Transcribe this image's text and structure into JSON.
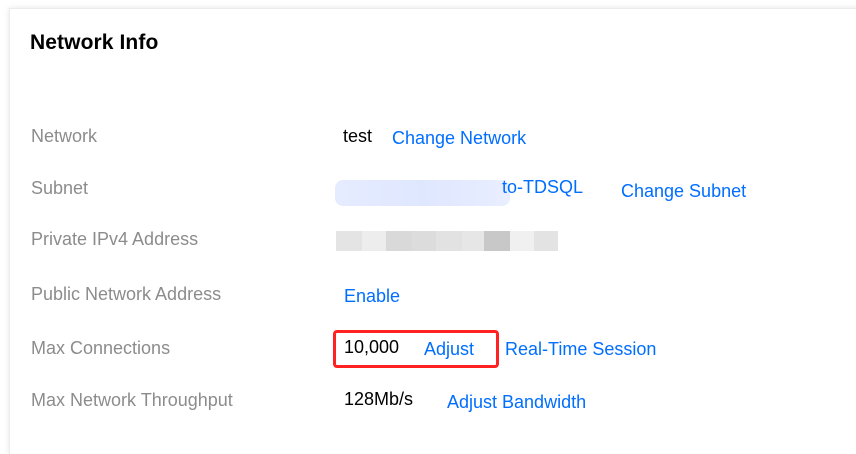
{
  "panel": {
    "title": "Network Info"
  },
  "rows": {
    "network": {
      "label": "Network",
      "value": "test",
      "action": "Change Network"
    },
    "subnet": {
      "label": "Subnet",
      "value_suffix": "to-TDSQL",
      "action": "Change Subnet"
    },
    "private_ip": {
      "label": "Private IPv4 Address"
    },
    "public_address": {
      "label": "Public Network Address",
      "action": "Enable"
    },
    "max_connections": {
      "label": "Max Connections",
      "value": "10,000",
      "action": "Adjust",
      "secondary_action": "Real-Time Session"
    },
    "throughput": {
      "label": "Max Network Throughput",
      "value": "128Mb/s",
      "action": "Adjust Bandwidth"
    }
  },
  "colors": {
    "link": "#006eff",
    "label": "#8c8c8c",
    "highlight": "#ff2222"
  }
}
